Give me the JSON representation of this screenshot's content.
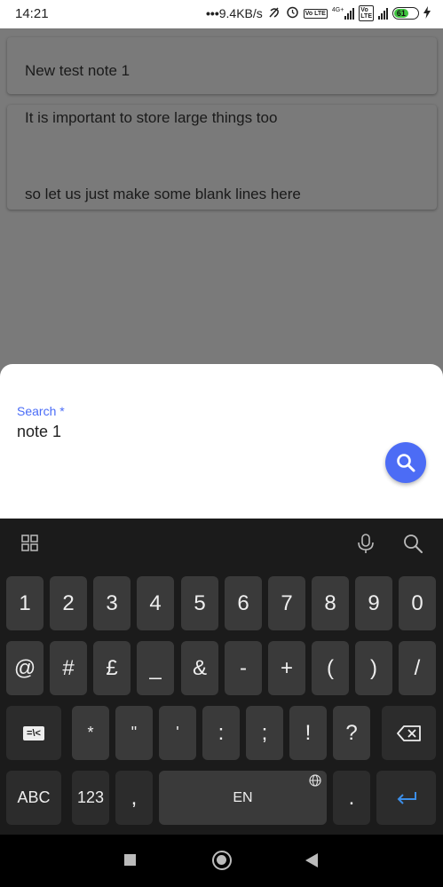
{
  "status_bar": {
    "time": "14:21",
    "speed": "9.4KB/s",
    "network": "4G+",
    "volte": "Vo LTE",
    "battery": "61"
  },
  "notes": [
    {
      "lines": [
        "New test note 1"
      ]
    },
    {
      "lines": [
        "It is important to store large things too",
        "so let us just make some blank lines here"
      ]
    }
  ],
  "search_sheet": {
    "label": "Search *",
    "value": "note 1",
    "accent": "#4c6cf5",
    "button_icon": "search-icon"
  },
  "keyboard": {
    "toolbar_icons": [
      "grid-icon",
      "mic-icon",
      "search-icon"
    ],
    "row1": [
      "1",
      "2",
      "3",
      "4",
      "5",
      "6",
      "7",
      "8",
      "9",
      "0"
    ],
    "row2": [
      "@",
      "#",
      "£",
      "_",
      "&",
      "-",
      "+",
      "(",
      ")",
      "/"
    ],
    "row3": [
      "*",
      "\"",
      "'",
      ":",
      ";",
      "!",
      "?"
    ],
    "row3_left": "=\\<",
    "abc": "ABC",
    "num": "123",
    "comma": ",",
    "space": "EN",
    "period": "."
  }
}
